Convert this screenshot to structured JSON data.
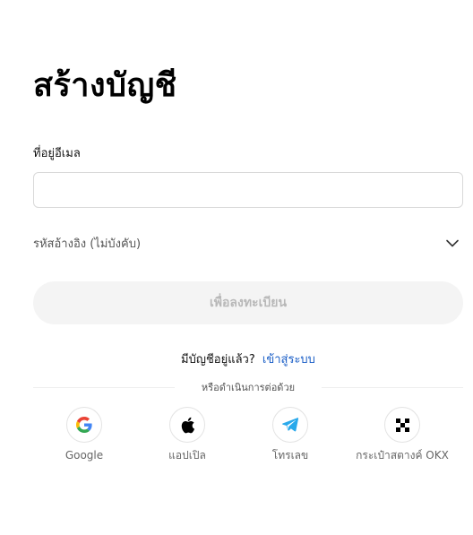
{
  "page": {
    "title": "สร้างบัญชี"
  },
  "email": {
    "label": "ที่อยู่อีเมล",
    "value": "",
    "placeholder": ""
  },
  "referral": {
    "label": "รหัสอ้างอิง (ไม่บังคับ)",
    "icon": "chevron-down-icon"
  },
  "signup_button": {
    "label": "เพื่อลงทะเบียน",
    "enabled": false
  },
  "login_prompt": {
    "text": "มีบัญชีอยู่แล้ว?",
    "link": "เข้าสู่ระบบ"
  },
  "divider": {
    "text": "หรือดำเนินการต่อด้วย"
  },
  "social": [
    {
      "label": "Google",
      "icon": "google-icon"
    },
    {
      "label": "แอปเปิล",
      "icon": "apple-icon"
    },
    {
      "label": "โทรเลข",
      "icon": "telegram-icon"
    },
    {
      "label": "กระเป๋าสตางค์ OKX",
      "icon": "okx-icon"
    }
  ],
  "colors": {
    "link": "#1a5ec7",
    "button_disabled_bg": "#f4f4f4",
    "button_disabled_text": "#b8b8b8",
    "telegram": "#29a9eb"
  }
}
